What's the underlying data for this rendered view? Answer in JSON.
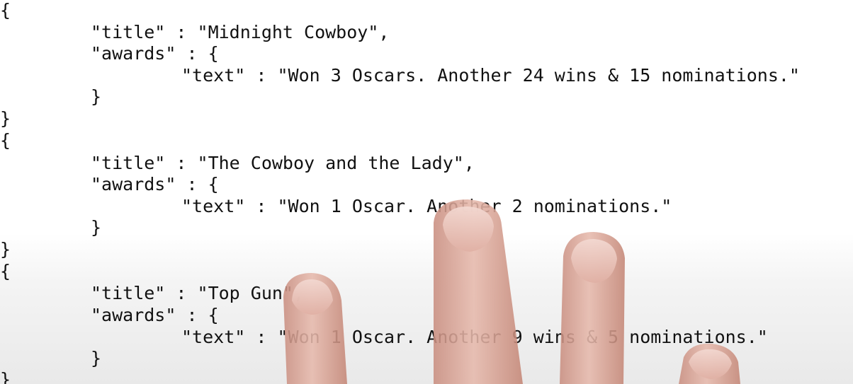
{
  "records": [
    {
      "open": "{",
      "title_line": "\"title\" : \"Midnight Cowboy\",",
      "awards_line": "\"awards\" : {",
      "text_line": "\"text\" : \"Won 3 Oscars. Another 24 wins & 15 nominations.\"",
      "inner_close": "}",
      "close": "}"
    },
    {
      "open": "{",
      "title_line": "\"title\" : \"The Cowboy and the Lady\",",
      "awards_line": "\"awards\" : {",
      "text_line": "\"text\" : \"Won 1 Oscar. Another 2 nominations.\"",
      "inner_close": "}",
      "close": "}"
    },
    {
      "open": "{",
      "title_line": "\"title\" : \"Top Gun\",",
      "awards_line": "\"awards\" : {",
      "text_line": "\"text\" : \"Won 1 Oscar. Another 9 wins & 5 nominations.\"",
      "inner_close": "}",
      "close": "}"
    }
  ],
  "colors": {
    "background": "#ffffff",
    "text": "#111111",
    "skin": "#d9a89a"
  }
}
